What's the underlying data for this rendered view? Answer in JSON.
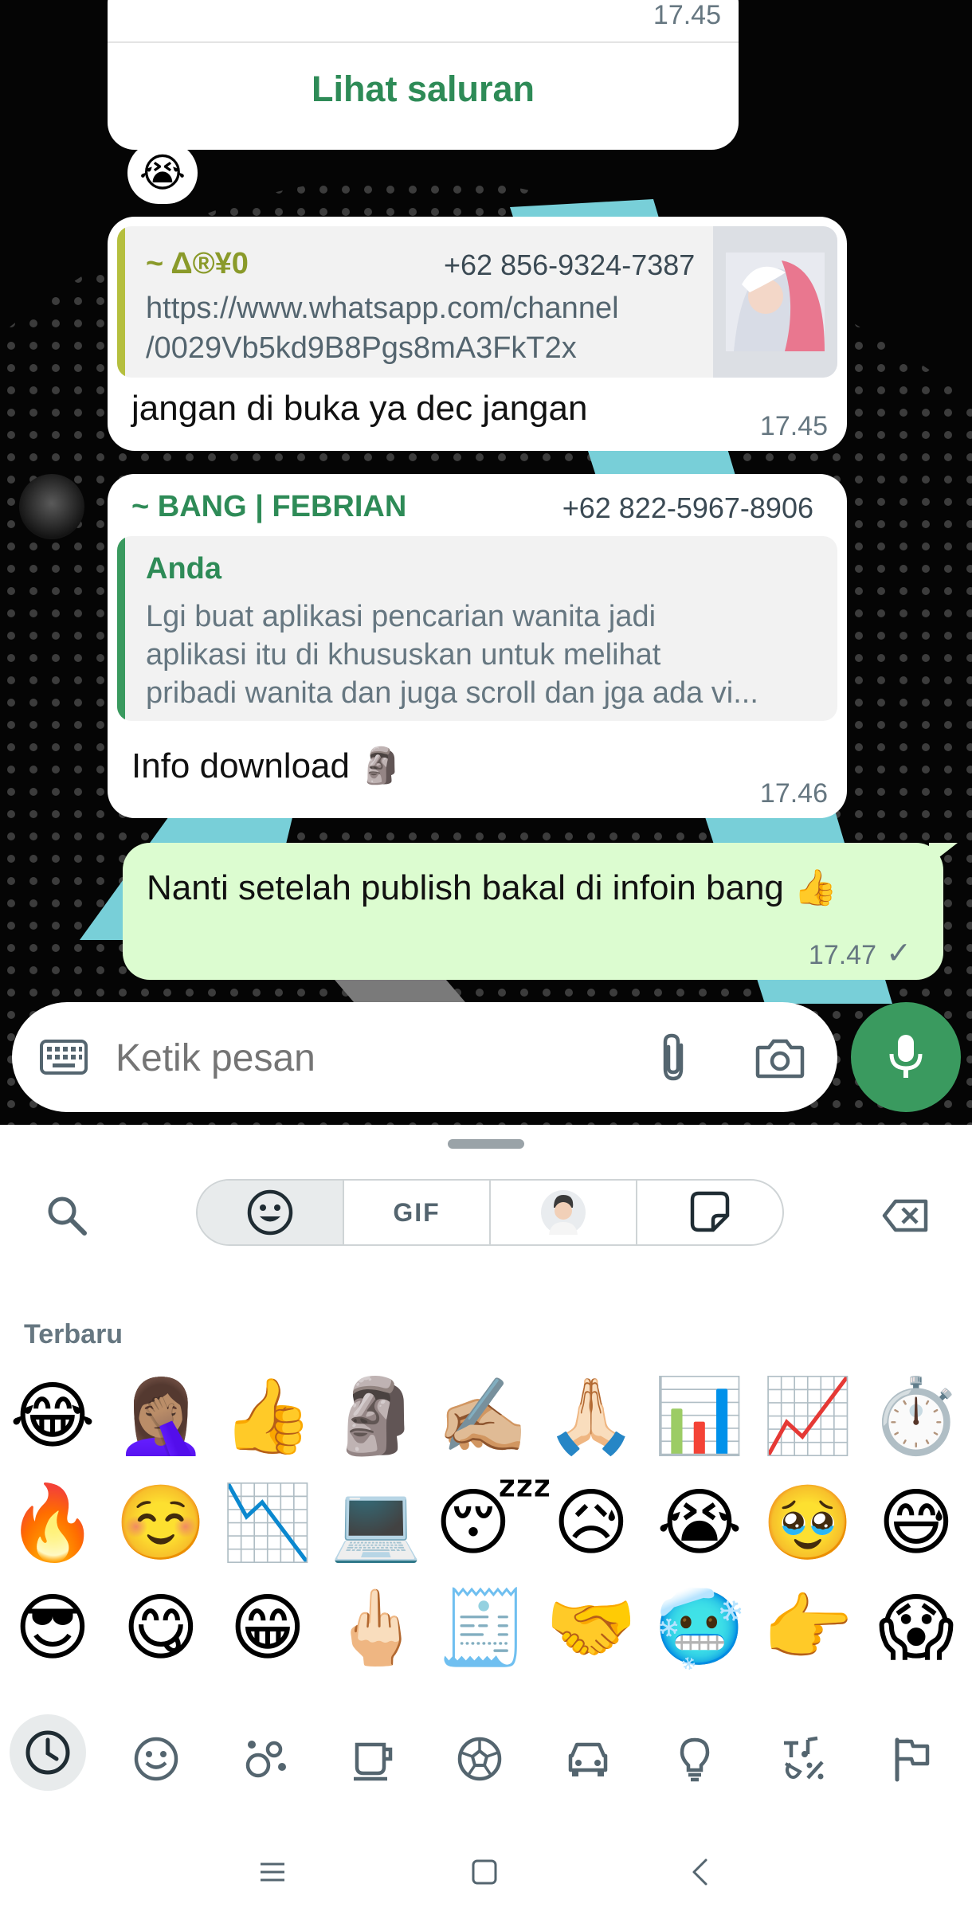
{
  "messages": {
    "channel_card": {
      "time": "17.45",
      "view_channel_label": "Lihat saluran"
    },
    "reaction": "😭",
    "forwarded_link": {
      "sender_name": "~ Δ®¥0",
      "sender_phone": "+62 856-9324-7387",
      "link_line1": "https://www.whatsapp.com/channel",
      "link_line2": "/0029Vb5kd9B8Pgs8mA3FkT2x",
      "body": "jangan di buka ya dec jangan",
      "time": "17.45"
    },
    "reply_message": {
      "sender_name": "~ BANG | FEBRIAN",
      "sender_phone": "+62 822-5967-8906",
      "quoted_author": "Anda",
      "quoted_line1": "Lgi buat aplikasi pencarian wanita jadi",
      "quoted_line2": "aplikasi itu di khususkan untuk melihat",
      "quoted_line3": "pribadi wanita dan juga scroll dan jga ada vi...",
      "body": "Info download",
      "body_emoji": "🗿",
      "time": "17.46"
    },
    "outgoing": {
      "body": "Nanti setelah publish bakal di infoin bang",
      "body_emoji": "👍",
      "time": "17.47",
      "status": "✓"
    }
  },
  "composer": {
    "placeholder": "Ketik pesan"
  },
  "emoji_panel": {
    "tabs": [
      "emoji",
      "gif",
      "avatar",
      "sticker"
    ],
    "gif_label": "GIF",
    "section_title": "Terbaru",
    "recent_emojis": [
      [
        "😂",
        "🤦🏽‍♀️",
        "👍",
        "🗿",
        "✍🏼",
        "🙏🏻",
        "📊",
        "📈",
        "⏱️"
      ],
      [
        "🔥",
        "☺️",
        "📉",
        "💻",
        "😴",
        "😥",
        "😭",
        "🥹",
        "😅"
      ],
      [
        "😎",
        "😋",
        "😁",
        "🖕🏻",
        "🧾",
        "🤝",
        "🥶",
        "👉",
        "😱"
      ]
    ],
    "categories": [
      "recent",
      "smileys",
      "animals",
      "food",
      "activities",
      "travel",
      "objects",
      "symbols",
      "flags"
    ]
  },
  "colors": {
    "accent_green": "#2e8b57",
    "outgoing_bubble": "#dcfcd0",
    "mic_button": "#3a9a5f"
  }
}
